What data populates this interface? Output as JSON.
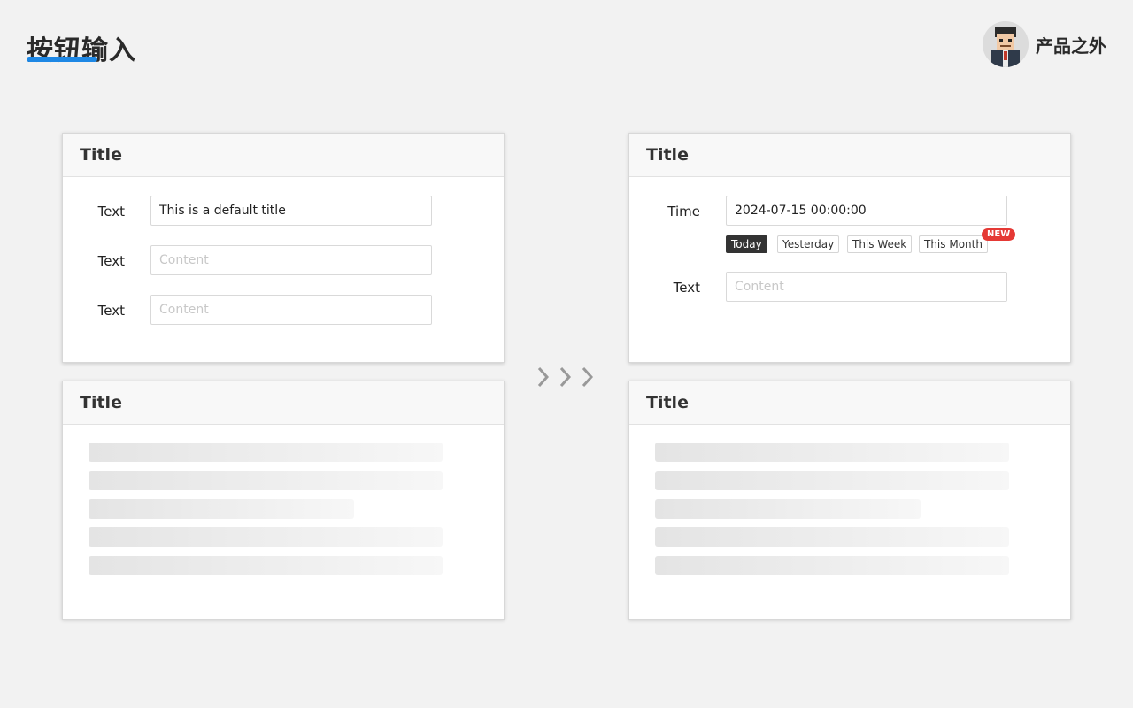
{
  "header": {
    "title": "按钮输入",
    "brand_name": "产品之外",
    "accent_color": "#1e88e5"
  },
  "left_top_card": {
    "title": "Title",
    "fields": [
      {
        "label": "Text",
        "value": "This is a default title",
        "placeholder": ""
      },
      {
        "label": "Text",
        "value": "",
        "placeholder": "Content"
      },
      {
        "label": "Text",
        "value": "",
        "placeholder": "Content"
      }
    ]
  },
  "left_bottom_card": {
    "title": "Title"
  },
  "right_top_card": {
    "title": "Title",
    "time_field": {
      "label": "Time",
      "value": "2024-07-15 00:00:00"
    },
    "quick_ranges": [
      {
        "label": "Today",
        "active": true
      },
      {
        "label": "Yesterday",
        "active": false
      },
      {
        "label": "This Week",
        "active": false
      },
      {
        "label": "This Month",
        "active": false
      }
    ],
    "badge": "NEW",
    "text_field": {
      "label": "Text",
      "value": "",
      "placeholder": "Content"
    }
  },
  "right_bottom_card": {
    "title": "Title"
  },
  "transition_icon": "triple-chevron-right-icon",
  "badge_color": "#e53935"
}
